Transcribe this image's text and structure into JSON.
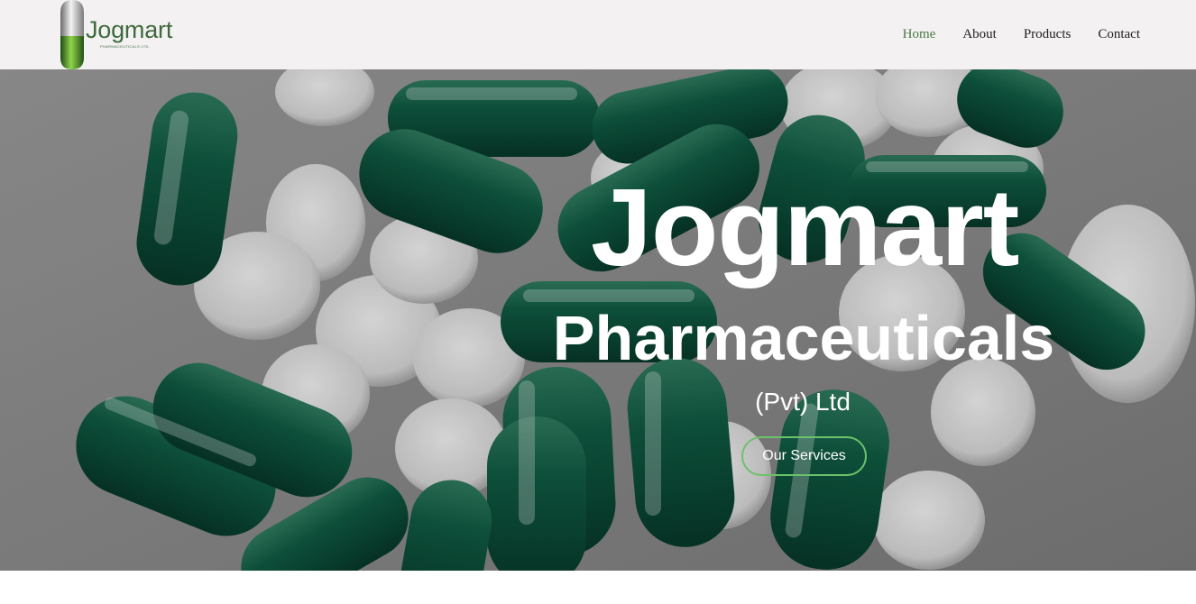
{
  "brand": {
    "name": "Jogmart",
    "tagline": "PHARMACEUTICALS LTD.",
    "pill_icon": "capsule-logo-icon"
  },
  "nav": {
    "items": [
      {
        "label": "Home",
        "active": true
      },
      {
        "label": "About",
        "active": false
      },
      {
        "label": "Products",
        "active": false
      },
      {
        "label": "Contact",
        "active": false
      }
    ]
  },
  "hero": {
    "title": "Jogmart",
    "subtitle": "Pharmaceuticals",
    "suffix": "(Pvt) Ltd",
    "cta_label": "Our Services",
    "background": "capsules-and-tablets-photo"
  },
  "colors": {
    "header_bg": "#f3f1f2",
    "brand_green": "#3f6a3c",
    "nav_active": "#4a7a42",
    "capsule_green": "#0f4f3a",
    "cta_border": "#6cc26a"
  }
}
